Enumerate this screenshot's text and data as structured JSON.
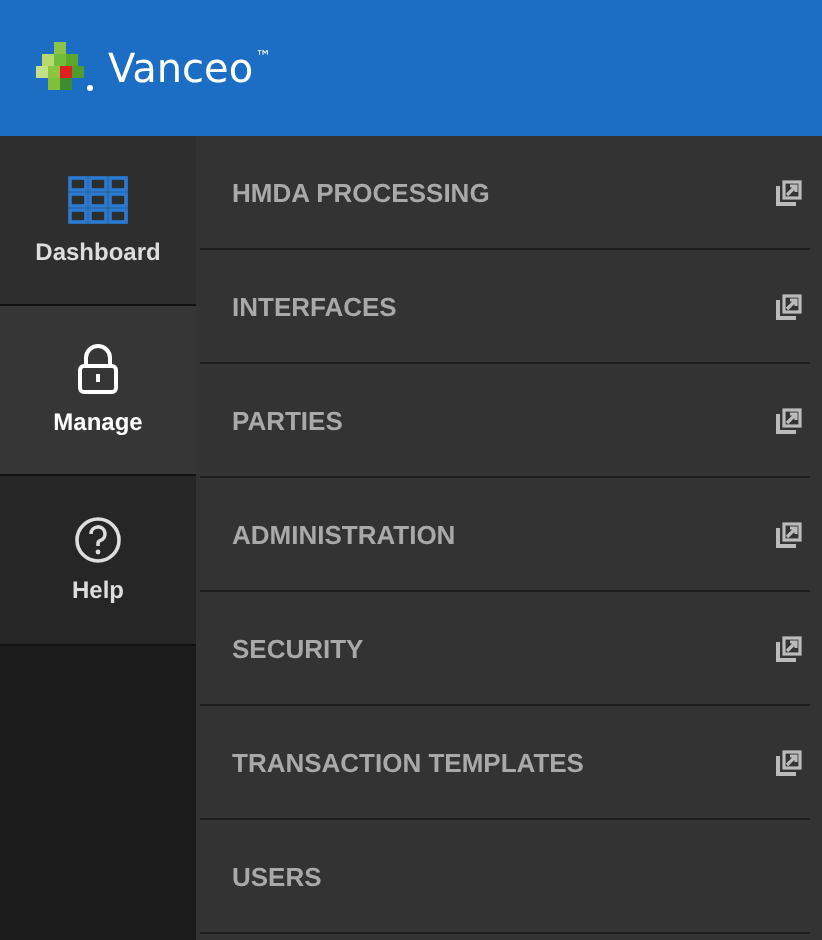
{
  "header": {
    "brand": "Vanceo",
    "trademark": "™"
  },
  "sidebar": {
    "items": [
      {
        "label": "Dashboard",
        "selected": false
      },
      {
        "label": "Manage",
        "selected": true
      },
      {
        "label": "Help",
        "selected": false
      }
    ]
  },
  "menu": {
    "items": [
      {
        "label": "HMDA PROCESSING",
        "external": true
      },
      {
        "label": "INTERFACES",
        "external": true
      },
      {
        "label": "PARTIES",
        "external": true
      },
      {
        "label": "ADMINISTRATION",
        "external": true
      },
      {
        "label": "SECURITY",
        "external": true
      },
      {
        "label": "TRANSACTION TEMPLATES",
        "external": true
      },
      {
        "label": "USERS",
        "external": false
      }
    ]
  }
}
